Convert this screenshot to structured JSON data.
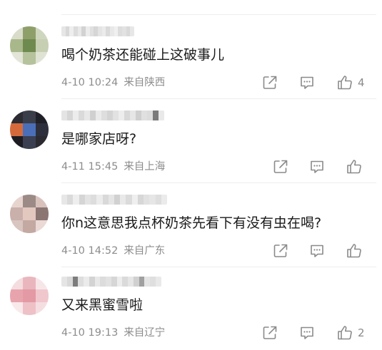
{
  "comments": [
    {
      "text": "喝个奶茶还能碰上这破事儿",
      "date": "4-10 10:24",
      "location": "来自陕西",
      "likes": "4",
      "avatar_colors": [
        "#d9dccb",
        "#8f9f6a",
        "#cfd6be",
        "#a8b88a",
        "#6f8a4e",
        "#c7cfb3",
        "#e2e5d8",
        "#b5c29c",
        "#dfe3d3"
      ],
      "name_colors": [
        "#e6e6e6",
        "#d8d8d8",
        "#eeeeee",
        "#dcdcdc",
        "#e9e9e9",
        "#d2d2d2",
        "#ececec",
        "#e0e0e0",
        "#d6d6d6",
        "#e4e4e4",
        "#ebebeb",
        "#dadada",
        "#e8e8e8",
        "#f0f0f0",
        "#dddddd",
        "#e2e2e2",
        "#d9d9d9",
        "#e7e7e7"
      ]
    },
    {
      "text": "是哪家店呀?",
      "date": "4-11 15:45",
      "location": "来自上海",
      "likes": "",
      "avatar_colors": [
        "#2b2b33",
        "#3a3d4a",
        "#1f1f28",
        "#d46a3c",
        "#4a6fb8",
        "#2d2f3c",
        "#1c1c22",
        "#3b3f52",
        "#2a2a30"
      ],
      "name_colors": [
        "#e4e4e4",
        "#d6d6d6",
        "#ececec",
        "#dadada",
        "#e8e8e8",
        "#d0d0d0",
        "#eaeaea",
        "#dedede",
        "#d4d4d4",
        "#e2e2e2",
        "#ededed",
        "#d8d8d8",
        "#e6e6e6",
        "#cfcfcf",
        "#e0e0e0",
        "#dcdcdc",
        "#7a7a7a",
        "#e9e9e9"
      ]
    },
    {
      "text": "你n这意思我点杯奶茶先看下有没有虫在喝?",
      "date": "4-10 14:52",
      "location": "来自广东",
      "likes": "",
      "avatar_colors": [
        "#e8d4cf",
        "#9c8a87",
        "#d9c2bc",
        "#c9b0aa",
        "#e3c8c0",
        "#8b7673",
        "#d8c5bf",
        "#c3a9a2",
        "#ead9d4"
      ],
      "name_colors": [
        "#e7e7e7",
        "#dadada",
        "#eeeeee",
        "#d5d5d5",
        "#e3e3e3",
        "#dddddd",
        "#ececec",
        "#d9d9d9",
        "#e5e5e5",
        "#d1d1d1",
        "#e9e9e9",
        "#dbdbdb",
        "#efefef",
        "#d7d7d7",
        "#e1e1e1",
        "#e6e6e6",
        "#dedede",
        "#ebebeb"
      ]
    },
    {
      "text": "又来黑蜜雪啦",
      "date": "4-10 19:13",
      "location": "来自辽宁",
      "likes": "2",
      "avatar_colors": [
        "#f4dcdf",
        "#eab6bd",
        "#f7e6e8",
        "#e8a4ad",
        "#e39aa4",
        "#f0c7cc",
        "#f8e9eb",
        "#eec1c7",
        "#f5dee1"
      ],
      "name_colors": [
        "#e5e5e5",
        "#d9d9d9",
        "#7d7d7d",
        "#dedede",
        "#ebebeb",
        "#d3d3d3",
        "#e8e8e8",
        "#dcdcdc",
        "#e2e2e2",
        "#d6d6d6",
        "#ededed",
        "#dadada",
        "#e6e6e6",
        "#d0d0d0",
        "#a0a0a0",
        "#e4e4e4",
        "#dfdfdf",
        "#e9e9e9"
      ]
    }
  ],
  "icons": {
    "share": "share-icon",
    "comment": "comment-icon",
    "like": "thumbs-up-icon"
  },
  "colors": {
    "text": "#1a1a1a",
    "meta": "#8c8c8c",
    "icon": "#8a8a8a",
    "divider": "#ededed"
  }
}
